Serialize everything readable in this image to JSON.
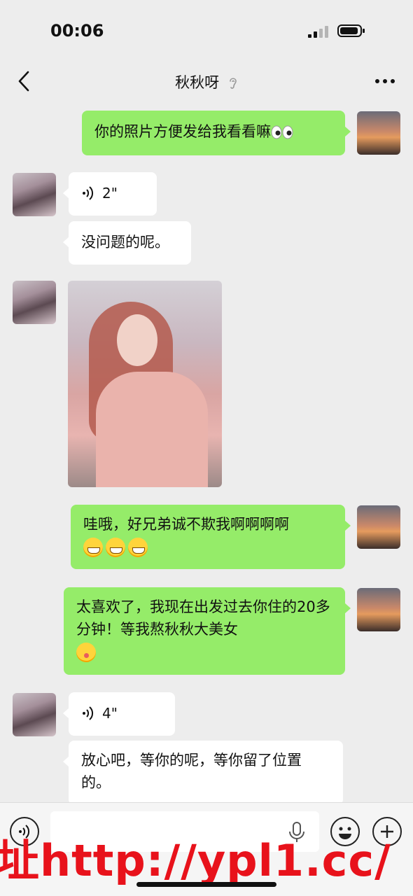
{
  "status": {
    "time": "00:06"
  },
  "header": {
    "title": "秋秋呀"
  },
  "messages": [
    {
      "side": "right",
      "text": "你的照片方便发给我看看嘛"
    },
    {
      "side": "left",
      "type": "voice",
      "duration": "2\""
    },
    {
      "side": "left",
      "text": "没问题的呢。"
    },
    {
      "side": "left",
      "type": "image"
    },
    {
      "side": "right",
      "text": "哇哦，好兄弟诚不欺我啊啊啊啊"
    },
    {
      "side": "right",
      "text": "太喜欢了，我现在出发过去你住的20多分钟！等我熬秋秋大美女"
    },
    {
      "side": "left",
      "type": "voice",
      "duration": "4\""
    },
    {
      "side": "left",
      "text": "放心吧，等你的呢，等你留了位置的。"
    }
  ],
  "watermark": {
    "text": "址http://ypl1.cc/"
  },
  "colors": {
    "sent_bubble": "#95ec69",
    "received_bubble": "#ffffff",
    "background": "#ededed",
    "watermark": "#e8121b"
  },
  "icons": [
    "back-icon",
    "ear-icon",
    "more-icon",
    "voice-wave-icon",
    "microphone-icon",
    "emoji-icon",
    "plus-icon",
    "signal-icon",
    "battery-icon"
  ]
}
